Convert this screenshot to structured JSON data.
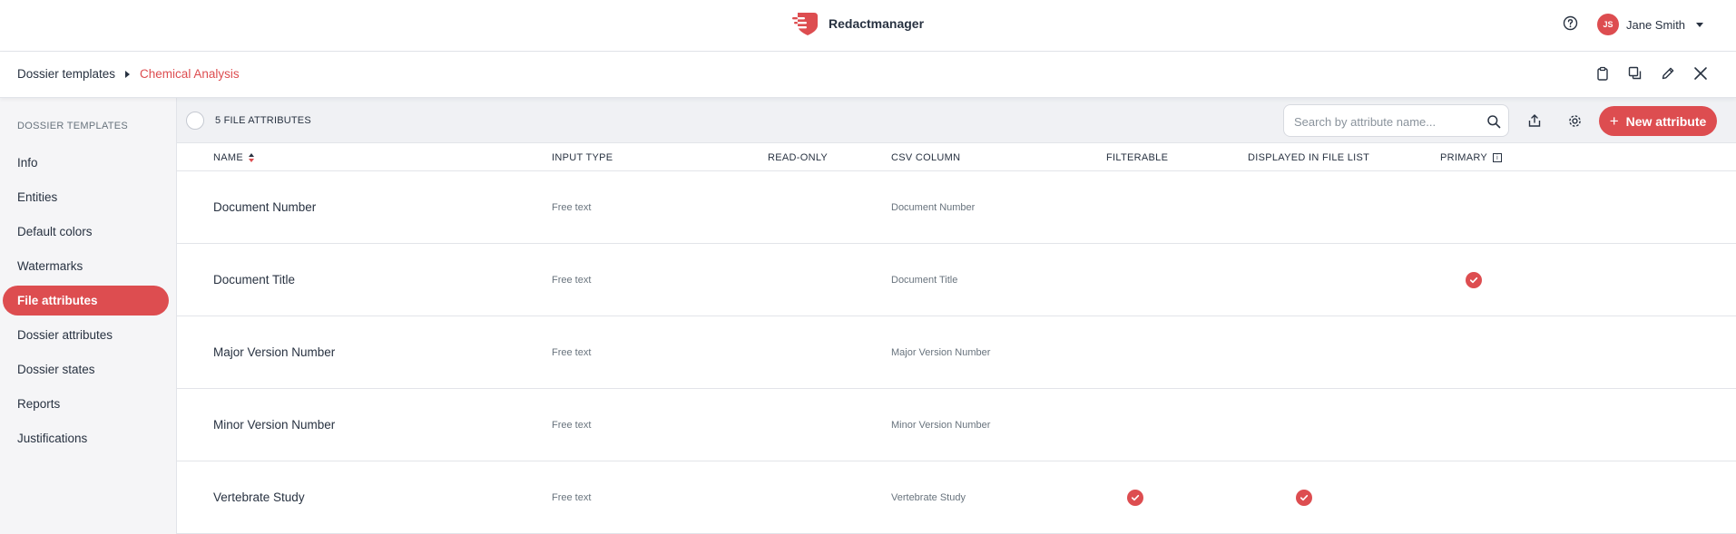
{
  "app": {
    "name": "Redactmanager",
    "brand_color": "#dd4d50",
    "user": {
      "initials": "JS",
      "name": "Jane Smith"
    }
  },
  "breadcrumb": {
    "items": [
      "Dossier templates"
    ],
    "current": "Chemical Analysis"
  },
  "header_actions": [
    "clipboard-icon",
    "copy-icon",
    "edit-icon",
    "close-icon"
  ],
  "sidebar": {
    "title": "DOSSIER TEMPLATES",
    "items": [
      {
        "label": "Info",
        "active": false
      },
      {
        "label": "Entities",
        "active": false
      },
      {
        "label": "Default colors",
        "active": false
      },
      {
        "label": "Watermarks",
        "active": false
      },
      {
        "label": "File attributes",
        "active": true
      },
      {
        "label": "Dossier attributes",
        "active": false
      },
      {
        "label": "Dossier states",
        "active": false
      },
      {
        "label": "Reports",
        "active": false
      },
      {
        "label": "Justifications",
        "active": false
      }
    ]
  },
  "toolbar": {
    "count_label": "5 FILE ATTRIBUTES",
    "search_placeholder": "Search by attribute name...",
    "new_button_label": "New attribute"
  },
  "table": {
    "columns": [
      "NAME",
      "INPUT TYPE",
      "READ-ONLY",
      "CSV COLUMN",
      "FILTERABLE",
      "DISPLAYED IN FILE LIST",
      "PRIMARY"
    ],
    "rows": [
      {
        "name": "Document Number",
        "input_type": "Free text",
        "read_only": false,
        "csv_column": "Document Number",
        "filterable": false,
        "displayed": false,
        "primary": false
      },
      {
        "name": "Document Title",
        "input_type": "Free text",
        "read_only": false,
        "csv_column": "Document Title",
        "filterable": false,
        "displayed": false,
        "primary": true
      },
      {
        "name": "Major Version Number",
        "input_type": "Free text",
        "read_only": false,
        "csv_column": "Major Version Number",
        "filterable": false,
        "displayed": false,
        "primary": false
      },
      {
        "name": "Minor Version Number",
        "input_type": "Free text",
        "read_only": false,
        "csv_column": "Minor Version Number",
        "filterable": false,
        "displayed": false,
        "primary": false
      },
      {
        "name": "Vertebrate Study",
        "input_type": "Free text",
        "read_only": false,
        "csv_column": "Vertebrate Study",
        "filterable": true,
        "displayed": true,
        "primary": false
      }
    ]
  }
}
